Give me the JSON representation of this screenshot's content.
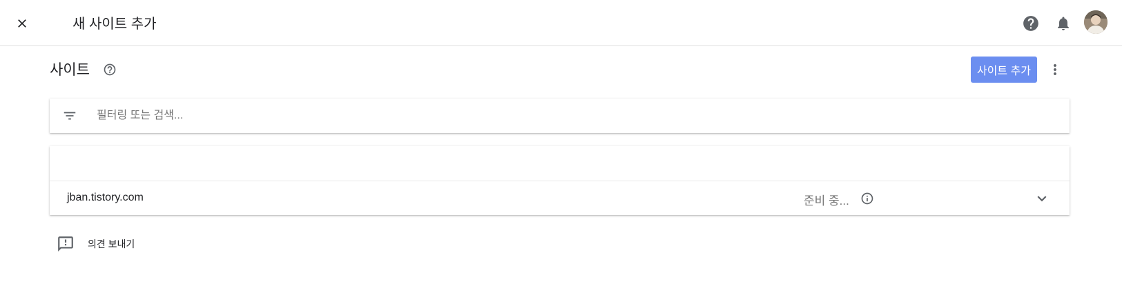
{
  "topbar": {
    "title": "새 사이트 추가",
    "close_icon": "close-icon",
    "help_icon": "help-circle-icon",
    "notifications_icon": "bell-icon",
    "avatar_icon": "user-avatar"
  },
  "page": {
    "title": "사이트",
    "help_icon": "help-outline-icon",
    "add_site_label": "사이트 추가",
    "more_icon": "more-vert-icon"
  },
  "search": {
    "placeholder": "필터링 또는 검색...",
    "value": "",
    "filter_icon": "filter-icon"
  },
  "sites": [
    {
      "domain": "jban.tistory.com",
      "status": "준비 중...",
      "status_icon": "info-icon",
      "expand_icon": "chevron-down-icon"
    }
  ],
  "feedback": {
    "label": "의견 보내기",
    "icon": "feedback-icon"
  },
  "colors": {
    "primary_button": "#6b8ef0",
    "text": "#202124",
    "secondary_text": "#757575",
    "icon": "#5f6368"
  }
}
